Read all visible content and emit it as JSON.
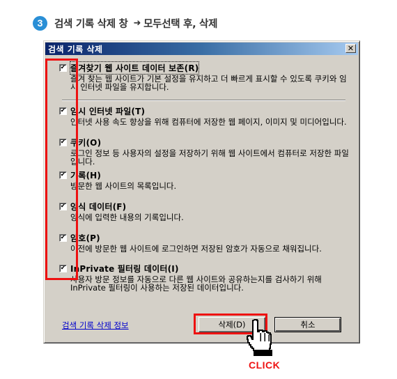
{
  "step": {
    "number": "3",
    "text": "검색 기록 삭제 창",
    "arrow": "➜",
    "action": "모두선택 후, 삭제"
  },
  "dialog": {
    "title": "검색 기록 삭제",
    "close_label": "✕",
    "items": [
      {
        "label": "즐겨찾기 웹 사이트 데이터 보존(R)",
        "checked": true,
        "desc": "즐겨 찾는 웹 사이트가 기본 설정을 유지하고 더 빠르게 표시할 수 있도록 쿠키와 임시 인터넷 파일을 유지합니다."
      },
      {
        "label": "임시 인터넷 파일(T)",
        "checked": true,
        "desc": "인터넷 사용 속도 향상을 위해 컴퓨터에 저장한 웹 페이지, 이미지 및 미디어입니다."
      },
      {
        "label": "쿠키(O)",
        "checked": true,
        "desc": "로그인 정보 등 사용자의 설정을 저장하기 위해 웹 사이트에서 컴퓨터로 저장한 파일입니다."
      },
      {
        "label": "기록(H)",
        "checked": true,
        "desc": "방문한 웹 사이트의 목록입니다."
      },
      {
        "label": "양식 데이터(F)",
        "checked": true,
        "desc": "양식에 입력한 내용의 기록입니다."
      },
      {
        "label": "암호(P)",
        "checked": true,
        "desc": "이전에 방문한 웹 사이트에 로그인하면 저장된 암호가 자동으로 채워집니다."
      },
      {
        "label": "InPrivate 필터링 데이터(I)",
        "checked": true,
        "desc": "사용자 방문 정보를 자동으로 다른 웹 사이트와 공유하는지를 검사하기 위해 InPrivate 필터링이 사용하는 저장된 데이터입니다."
      }
    ],
    "link": "검색 기록 삭제 정보",
    "delete_button": "삭제(D)",
    "cancel_button": "취소"
  },
  "annotation": {
    "click_label": "CLICK",
    "highlight_color": "#ee1111",
    "cursor": "hand-pointer-icon"
  },
  "colors": {
    "badge": "#2a8fd6",
    "titlebar_start": "#0a246a",
    "titlebar_end": "#a6caf0",
    "dialog_bg": "#d4d0c8",
    "link": "#0000cc"
  }
}
